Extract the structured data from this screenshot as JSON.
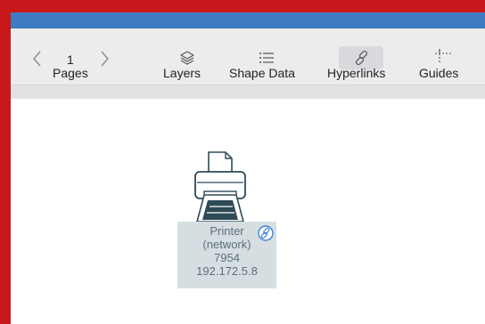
{
  "toolbar": {
    "pages": {
      "current_page": "1",
      "label": "Pages"
    },
    "layers": {
      "label": "Layers",
      "icon": "layers-icon"
    },
    "shape_data": {
      "label": "Shape Data",
      "icon": "list-icon"
    },
    "hyperlinks": {
      "label": "Hyperlinks",
      "icon": "link-icon",
      "active": true
    },
    "guides": {
      "label": "Guides",
      "icon": "guides-icon"
    }
  },
  "canvas": {
    "shape": {
      "icon": "printer-icon",
      "text_lines": [
        "Printer",
        "(network)",
        "7954",
        "192.172.5.8"
      ],
      "has_hyperlink": true
    }
  },
  "colors": {
    "outer_border": "#c8181b",
    "title_bar": "#3f7bc2",
    "toolbar_bg": "#ececec",
    "shape_text_bg": "#d6dee2",
    "link_badge": "#3d82d6"
  }
}
